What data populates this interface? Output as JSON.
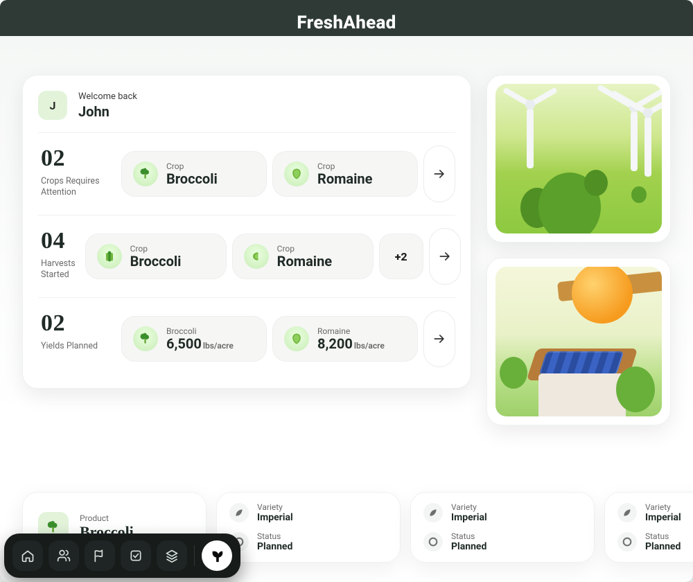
{
  "brand": "FreshAhead",
  "welcome": {
    "greeting": "Welcome back",
    "name": "John",
    "initial": "J"
  },
  "metrics": {
    "line0": " ",
    "attention": {
      "count": "02",
      "label": "Crops Requires Attention"
    },
    "harvests": {
      "count": "04",
      "label": "Harvests Started"
    },
    "yields": {
      "count": "02",
      "label": "Yields Planned"
    }
  },
  "tiles": {
    "crop_label": "Crop",
    "attention": [
      {
        "name": "Broccoli"
      },
      {
        "name": "Romaine"
      }
    ],
    "harvests": [
      {
        "name": "Broccoli"
      },
      {
        "name": "Romaine"
      }
    ],
    "harvests_more": "+2",
    "yields": [
      {
        "name": "Broccoli",
        "value": "6,500",
        "unit": "lbs/acre"
      },
      {
        "name": "Romaine",
        "value": "8,200",
        "unit": "lbs/acre"
      }
    ]
  },
  "products": {
    "head_label": "Product",
    "head_value": "Broccoli",
    "variety_label": "Variety",
    "status_label": "Status",
    "cards": [
      {
        "variety": "Imperial",
        "status": "Planned"
      },
      {
        "variety": "Imperial",
        "status": "Planned"
      },
      {
        "variety": "Imperial",
        "status": "Planned"
      }
    ]
  },
  "dock": {
    "items": [
      "home",
      "people",
      "flag",
      "checklist",
      "layers"
    ],
    "active": "sprout"
  }
}
